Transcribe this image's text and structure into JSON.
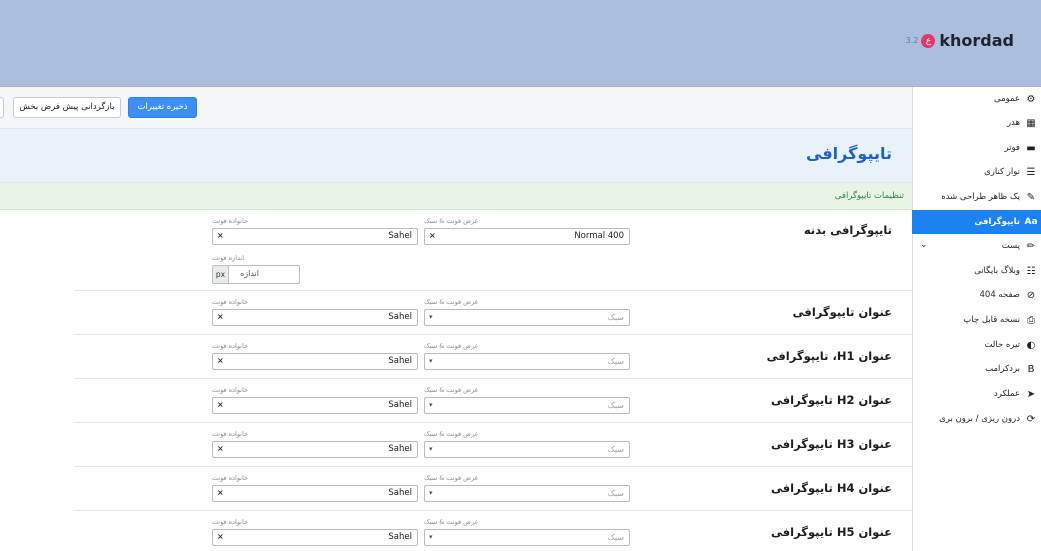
{
  "brand": {
    "version": "3.2",
    "logo": "ع",
    "name": "khordad"
  },
  "toolbar": {
    "save_label": "ذخیره تغییرات",
    "reset_label": "بازگردانی پیش فرض بخش"
  },
  "page": {
    "title": "تایپوگرافی",
    "section_title": "تنظیمات تایپوگرافی"
  },
  "sidebar": {
    "items": [
      {
        "label": "عمومی",
        "icon": "gear-icon",
        "glyph": "⚙"
      },
      {
        "label": "هدر",
        "icon": "header-icon",
        "glyph": "▦"
      },
      {
        "label": "فوتر",
        "icon": "footer-icon",
        "glyph": "▬"
      },
      {
        "label": "نوار کناری",
        "icon": "sidebar-icon",
        "glyph": "☰"
      },
      {
        "label": "یک ظاهر طراحی شده",
        "icon": "brush-icon",
        "glyph": "✎"
      },
      {
        "label": "تایپوگرافی",
        "icon": "typography-icon",
        "glyph": "Aa",
        "active": true
      },
      {
        "label": "پست",
        "icon": "pencil-icon",
        "glyph": "✏",
        "chevron": "⌄"
      },
      {
        "label": "وبلاگ بایگانی",
        "icon": "list-icon",
        "glyph": "☷"
      },
      {
        "label": "صفحه 404",
        "icon": "ban-icon",
        "glyph": "⊘"
      },
      {
        "label": "نسخه قابل چاپ",
        "icon": "print-icon",
        "glyph": "⎙"
      },
      {
        "label": "تیره حالت",
        "icon": "dark-mode-icon",
        "glyph": "◐"
      },
      {
        "label": "بردکرامب",
        "icon": "bold-icon",
        "glyph": "B"
      },
      {
        "label": "عملکرد",
        "icon": "rocket-icon",
        "glyph": "➤"
      },
      {
        "label": "درون ریزی / برون بری",
        "icon": "sync-icon",
        "glyph": "⟳"
      }
    ]
  },
  "fields": {
    "family_label": "خانواده فونت",
    "weight_label": "عرض فونت & سبک",
    "size_label": "اندازه فونت",
    "size_placeholder": "اندازه",
    "size_unit": "px",
    "style_placeholder": "سبک",
    "clear_glyph": "×",
    "caret_glyph": "▾"
  },
  "rows": [
    {
      "title": "تایپوگرافی بدنه",
      "family": "Sahel",
      "weight": "Normal 400"
    },
    {
      "title": "عنوان تایپوگرافی",
      "family": "Sahel",
      "weight": ""
    },
    {
      "title": "عنوان H1، تایپوگرافی",
      "family": "Sahel",
      "weight": ""
    },
    {
      "title": "عنوان H2 تایپوگرافی",
      "family": "Sahel",
      "weight": ""
    },
    {
      "title": "عنوان H3 تایپوگرافی",
      "family": "Sahel",
      "weight": ""
    },
    {
      "title": "عنوان H4 تایپوگرافی",
      "family": "Sahel",
      "weight": ""
    },
    {
      "title": "عنوان H5 تایپوگرافی",
      "family": "Sahel",
      "weight": ""
    }
  ]
}
